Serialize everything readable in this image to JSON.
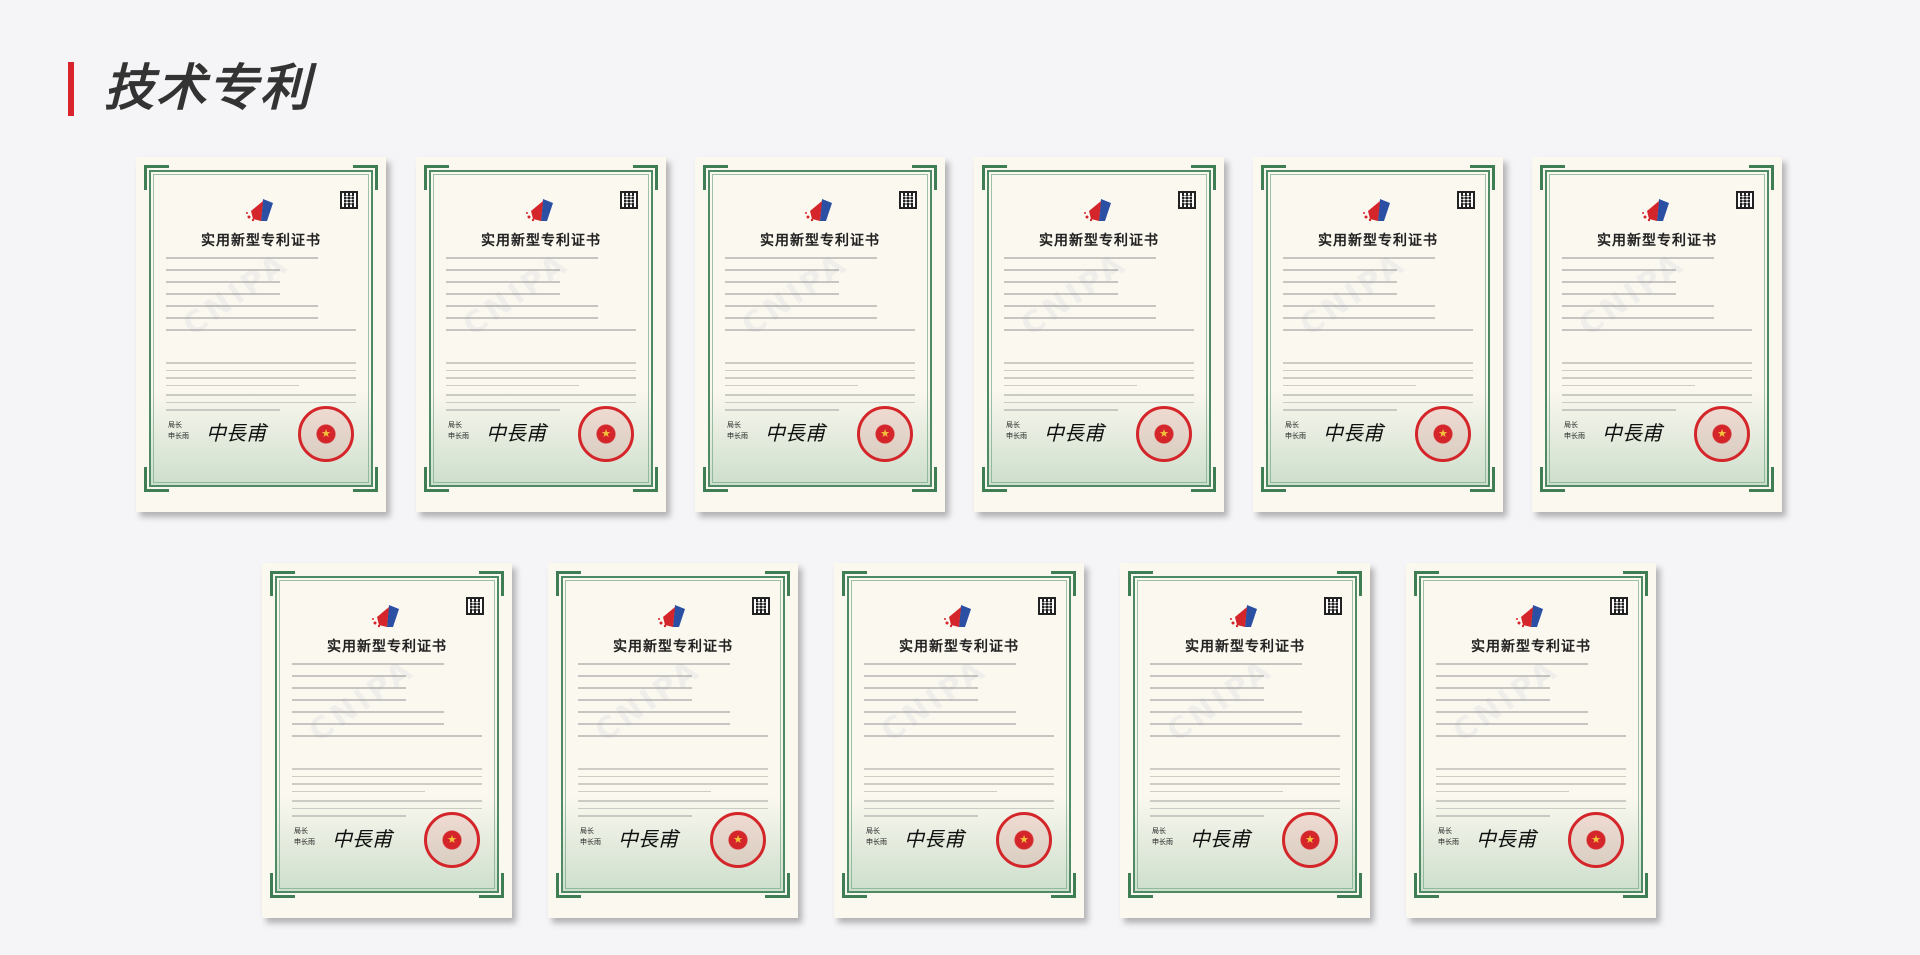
{
  "page": {
    "title": "技术专利"
  },
  "certificate_title": "实用新型专利证书",
  "watermark": "CNIPA",
  "signature_text": "中長甫",
  "signer_label_1": "局长",
  "signer_label_2": "申长雨",
  "colors": {
    "accent": "#d9232d",
    "frame": "#4e8a63",
    "seal": "#d4262a"
  },
  "certificates": [
    {
      "row": 1,
      "index": 1
    },
    {
      "row": 1,
      "index": 2
    },
    {
      "row": 1,
      "index": 3
    },
    {
      "row": 1,
      "index": 4
    },
    {
      "row": 1,
      "index": 5
    },
    {
      "row": 1,
      "index": 6
    },
    {
      "row": 2,
      "index": 7
    },
    {
      "row": 2,
      "index": 8
    },
    {
      "row": 2,
      "index": 9
    },
    {
      "row": 2,
      "index": 10
    },
    {
      "row": 2,
      "index": 11
    }
  ]
}
